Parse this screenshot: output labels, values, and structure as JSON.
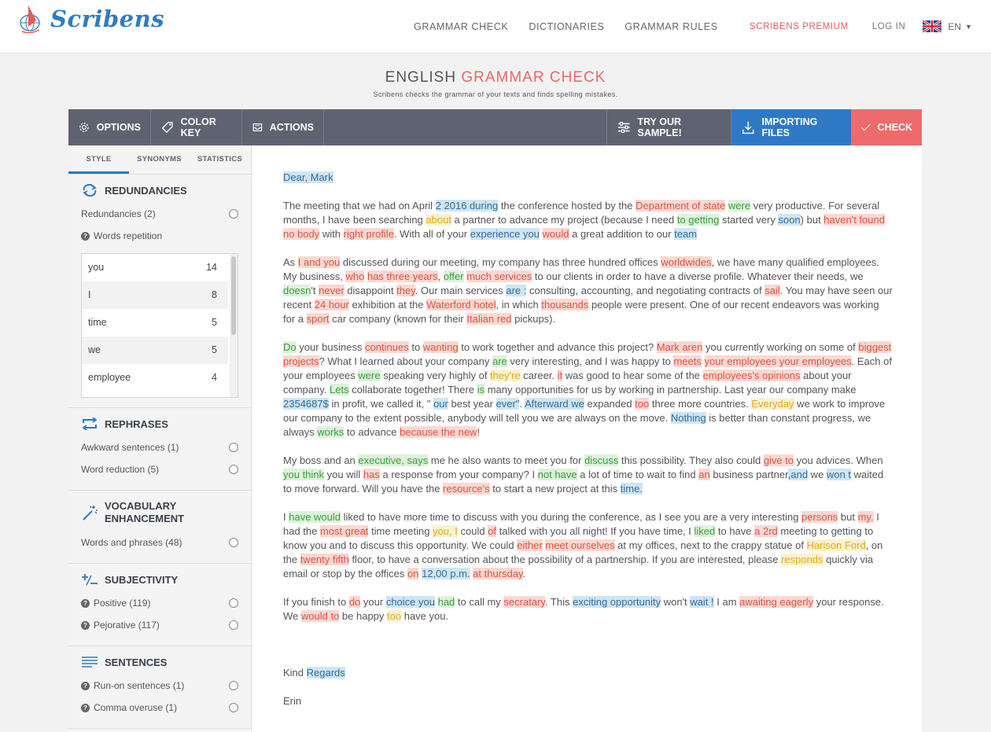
{
  "header": {
    "logo_text": "Scribens",
    "nav": [
      "GRAMMAR CHECK",
      "DICTIONARIES",
      "GRAMMAR RULES"
    ],
    "premium": "SCRIBENS PREMIUM",
    "login": "LOG IN",
    "lang": "EN"
  },
  "title": {
    "part1": "ENGLISH",
    "part2": "GRAMMAR CHECK",
    "subtitle": "Scribens checks the grammar of your texts and finds spelling mistakes."
  },
  "toolbar": {
    "options": "OPTIONS",
    "colorkey": "COLOR KEY",
    "actions": "ACTIONS",
    "sample": "TRY OUR SAMPLE!",
    "import": "IMPORTING FILES",
    "check": "CHECK"
  },
  "sidebar": {
    "tabs": [
      "STYLE",
      "SYNONYMS",
      "STATISTICS"
    ],
    "redundancies": {
      "title": "REDUNDANCIES",
      "item": "Redundancies (2)",
      "repetition": "Words repetition",
      "words": [
        {
          "word": "you",
          "count": "14"
        },
        {
          "word": "I",
          "count": "8"
        },
        {
          "word": "time",
          "count": "5"
        },
        {
          "word": "we",
          "count": "5"
        },
        {
          "word": "employee",
          "count": "4"
        }
      ]
    },
    "rephrases": {
      "title": "REPHRASES",
      "items": [
        "Awkward sentences (1)",
        "Word reduction (5)"
      ]
    },
    "vocabulary": {
      "title1": "VOCABULARY",
      "title2": "ENHANCEMENT",
      "items": [
        "Words and phrases (48)"
      ]
    },
    "subjectivity": {
      "title": "SUBJECTIVITY",
      "items": [
        "Positive (119)",
        "Pejorative (117)"
      ]
    },
    "sentences": {
      "title": "SENTENCES",
      "items": [
        "Run-on sentences (1)",
        "Comma overuse (1)"
      ]
    }
  },
  "doc": [
    [
      [
        "Dear, Mark",
        "b"
      ]
    ],
    [
      [
        "The meeting that we had on April "
      ],
      [
        "2 2016 during",
        "b"
      ],
      [
        " the conference hosted by the "
      ],
      [
        "Department of state",
        "r"
      ],
      [
        " "
      ],
      [
        "were",
        "g"
      ],
      [
        " very productive. For several months, I have been searching "
      ],
      [
        "about",
        "y"
      ],
      [
        " a partner to advance my project (because I need "
      ],
      [
        "to getting",
        "g"
      ],
      [
        " started very "
      ],
      [
        "soon",
        "b"
      ],
      [
        ") but "
      ],
      [
        "haven't found no body",
        "r"
      ],
      [
        " with "
      ],
      [
        "right profile",
        "r"
      ],
      [
        ". With all of your "
      ],
      [
        "experience you",
        "b"
      ],
      [
        " "
      ],
      [
        "would",
        "r"
      ],
      [
        " a great addition to our "
      ],
      [
        "team",
        "b"
      ]
    ],
    [
      [
        "As "
      ],
      [
        "I and you",
        "r"
      ],
      [
        " discussed during our meeting, my company has three hundred offices "
      ],
      [
        "worldwides",
        "r"
      ],
      [
        ", we have many qualified employees. My business, "
      ],
      [
        "who",
        "r"
      ],
      [
        " "
      ],
      [
        "has three years",
        "r"
      ],
      [
        ", "
      ],
      [
        "offer",
        "g"
      ],
      [
        " "
      ],
      [
        "much services",
        "r"
      ],
      [
        " to our clients in order to have a diverse profile. Whatever their needs, we "
      ],
      [
        "doesn",
        "g"
      ],
      [
        "'t "
      ],
      [
        "never",
        "r"
      ],
      [
        " disappoint "
      ],
      [
        "they",
        "r"
      ],
      [
        ". Our main services "
      ],
      [
        "are :",
        "b"
      ],
      [
        " consulting, accounting, and negotiating contracts of "
      ],
      [
        "sail",
        "r"
      ],
      [
        ". You may have seen our recent "
      ],
      [
        "24 hour",
        "r"
      ],
      [
        " exhibition at the "
      ],
      [
        "Waterford hotel",
        "r"
      ],
      [
        ", in which "
      ],
      [
        "thousands",
        "r"
      ],
      [
        " people were present. One of our recent endeavors was working for a "
      ],
      [
        "sport",
        "r"
      ],
      [
        " car company (known for their "
      ],
      [
        "Italian red",
        "r"
      ],
      [
        " pickups)."
      ]
    ],
    [
      [
        "Do",
        "g"
      ],
      [
        " your business "
      ],
      [
        "continues",
        "r"
      ],
      [
        " to "
      ],
      [
        "wanting",
        "r"
      ],
      [
        " to work together and advance this project? "
      ],
      [
        "Mark aren",
        "r"
      ],
      [
        " you currently working on some of "
      ],
      [
        "biggest projects",
        "r"
      ],
      [
        "? What I learned about your company "
      ],
      [
        "are",
        "g"
      ],
      [
        " very interesting, and I was happy to "
      ],
      [
        "meets",
        "r"
      ],
      [
        " "
      ],
      [
        "your employees your employees",
        "r"
      ],
      [
        ". Each of your employees "
      ],
      [
        "were",
        "g"
      ],
      [
        " speaking very highly of "
      ],
      [
        "they're",
        "y"
      ],
      [
        " career. "
      ],
      [
        "it",
        "r"
      ],
      [
        " was good to hear some of the "
      ],
      [
        "employees's opinions",
        "r"
      ],
      [
        " about your company. "
      ],
      [
        "Lets",
        "g"
      ],
      [
        " collaborate together! There "
      ],
      [
        "is",
        "g"
      ],
      [
        " many opportunities for us by working in partnership. Last year our company make "
      ],
      [
        "2354687$",
        "b"
      ],
      [
        " in profit, we called it, \" "
      ],
      [
        "our",
        "b"
      ],
      [
        " best year "
      ],
      [
        "ever\"",
        "b"
      ],
      [
        ". "
      ],
      [
        "Afterward we",
        "b"
      ],
      [
        " expanded "
      ],
      [
        "too",
        "r"
      ],
      [
        " three more countries. "
      ],
      [
        "Everyday",
        "y"
      ],
      [
        " we work to improve our company to the extent possible, anybody will tell you we are always on the move. "
      ],
      [
        "  Nothing",
        "b"
      ],
      [
        " is better than constant progress, we always "
      ],
      [
        "works",
        "g"
      ],
      [
        " to advance "
      ],
      [
        "because the new",
        "r"
      ],
      [
        "!"
      ]
    ],
    [
      [
        "My boss and an "
      ],
      [
        "executive, says",
        "g"
      ],
      [
        " me he also wants to meet you for "
      ],
      [
        "discuss",
        "g"
      ],
      [
        " this possibility. They also could "
      ],
      [
        "give to",
        "r"
      ],
      [
        " you advices. When "
      ],
      [
        "you think",
        "g"
      ],
      [
        " you will "
      ],
      [
        "has",
        "r"
      ],
      [
        " a response from your company? I "
      ],
      [
        "not have",
        "g"
      ],
      [
        " a lot of time to wait to find "
      ],
      [
        "an",
        "r"
      ],
      [
        " business partner"
      ],
      [
        ",and",
        "b"
      ],
      [
        " we "
      ],
      [
        "won t",
        "b"
      ],
      [
        " waited to move forward. Will you have the "
      ],
      [
        "resource's",
        "r"
      ],
      [
        " to start a new project at this "
      ],
      [
        "time.",
        "b"
      ]
    ],
    [
      [
        "I "
      ],
      [
        "have would",
        "g"
      ],
      [
        " liked to have more time to discuss with you during the conference, as I see you are a very interesting "
      ],
      [
        "persons",
        "r"
      ],
      [
        " but "
      ],
      [
        "my.",
        "r"
      ],
      [
        " I had the "
      ],
      [
        "most great",
        "r"
      ],
      [
        " time meeting "
      ],
      [
        "you, I",
        "y"
      ],
      [
        " could "
      ],
      [
        "of",
        "r"
      ],
      [
        " talked with you all night! If you have time, I "
      ],
      [
        "liked",
        "g"
      ],
      [
        " to have "
      ],
      [
        "a 2rd",
        "r"
      ],
      [
        " meeting to getting to know you and to discuss this opportunity. We could "
      ],
      [
        "either",
        "r"
      ],
      [
        " "
      ],
      [
        "meet ourselves",
        "r"
      ],
      [
        " at my offices, next to the crappy statue of "
      ],
      [
        "Harison Ford",
        "y"
      ],
      [
        ", on the "
      ],
      [
        "twenty fifth",
        "r"
      ],
      [
        " floor, to have a conversation about the possibility of a partnership. If you are interested, please "
      ],
      [
        "responds",
        "y"
      ],
      [
        " quickly via email or stop by the offices "
      ],
      [
        "on",
        "r"
      ],
      [
        " "
      ],
      [
        "12,00 p.m.",
        "b"
      ],
      [
        " "
      ],
      [
        "at thursday",
        "r"
      ],
      [
        "."
      ]
    ],
    [
      [
        "If you finish to "
      ],
      [
        "do",
        "r"
      ],
      [
        " your "
      ],
      [
        "choice you",
        "b"
      ],
      [
        " "
      ],
      [
        "had",
        "g"
      ],
      [
        " to call my "
      ],
      [
        "secratary",
        "r"
      ],
      [
        ". This "
      ],
      [
        "exciting  opportunity",
        "b"
      ],
      [
        " won't "
      ],
      [
        "wait !",
        "b"
      ],
      [
        " I am "
      ],
      [
        "awaiting eagerly",
        "r"
      ],
      [
        " your response. We "
      ],
      [
        "would to",
        "r"
      ],
      [
        " be happy "
      ],
      [
        "too",
        "y"
      ],
      [
        " have you."
      ]
    ],
    [],
    [
      [
        "Kind "
      ],
      [
        "Regards",
        "b"
      ]
    ],
    [
      [
        "Erin"
      ]
    ]
  ]
}
